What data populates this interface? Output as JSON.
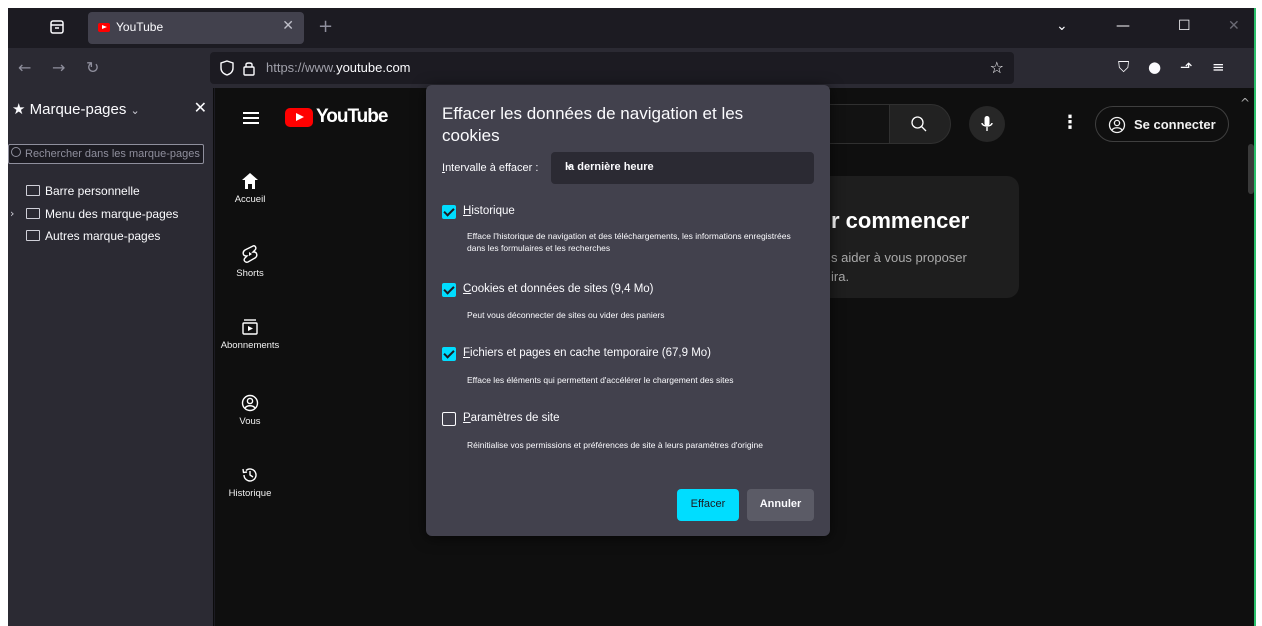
{
  "browser": {
    "tab": {
      "title": "YouTube"
    },
    "url": {
      "prefix": "https://www.",
      "domain": "youtube.com"
    }
  },
  "sidebar": {
    "title": "Marque-pages",
    "title_chevron": "⌄",
    "search_placeholder": "Rechercher dans les marque-pages",
    "items": [
      {
        "label": "Barre personnelle"
      },
      {
        "label": "Menu des marque-pages"
      },
      {
        "label": "Autres marque-pages"
      }
    ]
  },
  "youtube": {
    "logo_text": "YouTube",
    "guide": [
      {
        "label": "Accueil",
        "icon": "home-icon"
      },
      {
        "label": "Shorts",
        "icon": "shorts-icon"
      },
      {
        "label": "Abonnements",
        "icon": "subscriptions-icon"
      },
      {
        "label": "Vous",
        "icon": "you-icon"
      },
      {
        "label": "Historique",
        "icon": "history-icon"
      }
    ],
    "signin_label": "Se connecter",
    "card": {
      "heading": "r commencer",
      "text_line1": "s aider à vous proposer",
      "text_line2": "ira."
    }
  },
  "dialog": {
    "title": "Effacer les données de navigation et les cookies",
    "range_label_u": "I",
    "range_label_rest": "ntervalle à effacer :",
    "range_value": "la dernière heure",
    "options": [
      {
        "u": "H",
        "rest": "istorique",
        "checked": true,
        "desc": "Efface l'historique de navigation et des téléchargements, les informations enregistrées dans les formulaires et les recherches"
      },
      {
        "u": "C",
        "rest": "ookies et données de sites (9,4 Mo)",
        "checked": true,
        "desc": "Peut vous déconnecter de sites ou vider des paniers"
      },
      {
        "u": "F",
        "rest": "ichiers et pages en cache temporaire (67,9 Mo)",
        "checked": true,
        "desc": "Efface les éléments qui permettent d'accélérer le chargement des sites"
      },
      {
        "u": "P",
        "rest": "aramètres de site",
        "checked": false,
        "desc": "Réinitialise vos permissions et préférences de site à leurs paramètres d'origine"
      }
    ],
    "confirm_label": "Effacer",
    "cancel_label": "Annuler"
  },
  "colors": {
    "accent": "#00ddff",
    "dialog_bg": "#42414d",
    "youtube_red": "#ff0000"
  }
}
